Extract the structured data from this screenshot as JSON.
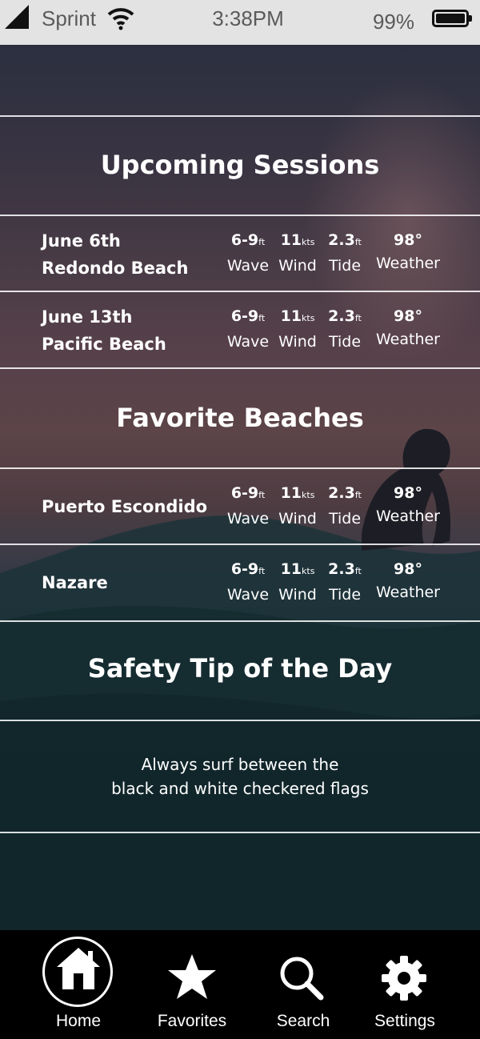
{
  "status_bar": {
    "carrier": "Sprint",
    "time": "3:38PM",
    "battery": "99%"
  },
  "upcoming": {
    "title": "Upcoming Sessions",
    "sessions": [
      {
        "date": "June 6th",
        "beach": "Redondo Beach",
        "wave": "6-9",
        "wave_unit": "ft",
        "wind": "11",
        "wind_unit": "kts",
        "tide": "2.3",
        "tide_unit": "ft",
        "weather": "98°"
      },
      {
        "date": "June 13th",
        "beach": "Pacific Beach",
        "wave": "6-9",
        "wave_unit": "ft",
        "wind": "11",
        "wind_unit": "kts",
        "tide": "2.3",
        "tide_unit": "ft",
        "weather": "98°"
      }
    ]
  },
  "favorites": {
    "title": "Favorite Beaches",
    "beaches": [
      {
        "name": "Puerto Escondido",
        "wave": "6-9",
        "wave_unit": "ft",
        "wind": "11",
        "wind_unit": "kts",
        "tide": "2.3",
        "tide_unit": "ft",
        "weather": "98°"
      },
      {
        "name": "Nazare",
        "wave": "6-9",
        "wave_unit": "ft",
        "wind": "11",
        "wind_unit": "kts",
        "tide": "2.3",
        "tide_unit": "ft",
        "weather": "98°"
      }
    ]
  },
  "stat_labels": {
    "wave": "Wave",
    "wind": "Wind",
    "tide": "Tide",
    "weather": "Weather"
  },
  "safety": {
    "title": "Safety Tip of the Day",
    "line1": "Always surf between the",
    "line2": "black and white checkered flags"
  },
  "nav": {
    "home": "Home",
    "favorites": "Favorites",
    "search": "Search",
    "settings": "Settings",
    "active": "home"
  },
  "icons": [
    "signal-icon",
    "wifi-icon",
    "battery-icon",
    "home-icon",
    "star-icon",
    "search-icon",
    "gear-icon"
  ]
}
